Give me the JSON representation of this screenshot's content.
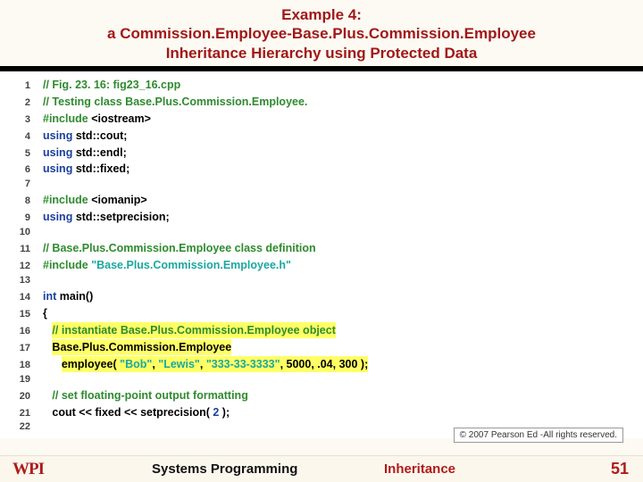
{
  "title": {
    "line1": "Example 4:",
    "line2": "a Commission.Employee-Base.Plus.Commission.Employee",
    "line3": "Inheritance Hierarchy using Protected Data"
  },
  "code": {
    "lines": [
      {
        "n": "1",
        "html": "<span class='comment'>// Fig. 23. 16: fig23_16.cpp</span>"
      },
      {
        "n": "2",
        "html": "<span class='comment'>// Testing class Base.Plus.Commission.Employee.</span>"
      },
      {
        "n": "3",
        "html": "<span class='pre'>#include</span> &lt;iostream&gt;"
      },
      {
        "n": "4",
        "html": "<span class='kw'>using</span> std::cout;"
      },
      {
        "n": "5",
        "html": "<span class='kw'>using</span> std::endl;"
      },
      {
        "n": "6",
        "html": "<span class='kw'>using</span> std::fixed;"
      },
      {
        "n": "7",
        "html": ""
      },
      {
        "n": "8",
        "html": "<span class='pre'>#include</span> &lt;iomanip&gt;"
      },
      {
        "n": "9",
        "html": "<span class='kw'>using</span> std::setprecision;"
      },
      {
        "n": "10",
        "html": ""
      },
      {
        "n": "11",
        "html": "<span class='comment'>// Base.Plus.Commission.Employee class definition</span>"
      },
      {
        "n": "12",
        "html": "<span class='pre'>#include</span> <span class='str'>\"Base.Plus.Commission.Employee.h\"</span>"
      },
      {
        "n": "13",
        "html": ""
      },
      {
        "n": "14",
        "html": "<span class='kw'>int</span> main()"
      },
      {
        "n": "15",
        "html": "{"
      },
      {
        "n": "16",
        "html": "   <span class='hl'><span class='comment'>// instantiate Base.Plus.Commission.Employee object</span></span>"
      },
      {
        "n": "17",
        "html": "   <span class='hl'>Base.Plus.Commission.Employee</span>"
      },
      {
        "n": "18",
        "html": "      <span class='hl'>employee( <span class='str'>\"Bob\"</span>, <span class='str'>\"Lewis\"</span>, <span class='str'>\"333-33-3333\"</span>, 5000, .04, 300 );</span>"
      },
      {
        "n": "19",
        "html": ""
      },
      {
        "n": "20",
        "html": "   <span class='comment'>// set floating-point output formatting</span>"
      },
      {
        "n": "21",
        "html": "   cout &lt;&lt; fixed &lt;&lt; setprecision( <span class='num'>2</span> );"
      },
      {
        "n": "22",
        "html": ""
      }
    ]
  },
  "copyright": "© 2007 Pearson Ed -All rights reserved.",
  "footer": {
    "logo": "WPI",
    "course": "Systems Programming",
    "topic": "Inheritance",
    "page": "51"
  }
}
